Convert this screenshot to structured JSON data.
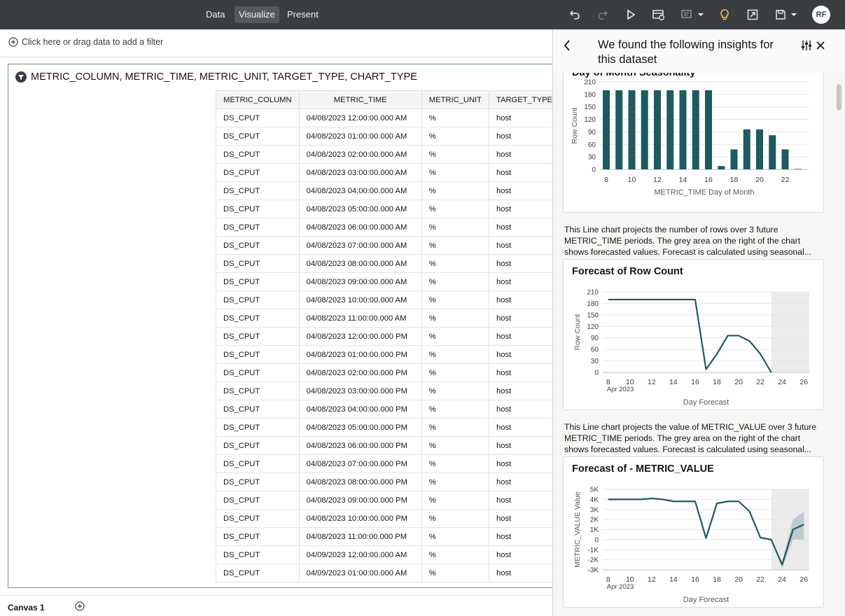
{
  "topbar": {
    "tabs": [
      {
        "label": "Data",
        "active": false
      },
      {
        "label": "Visualize",
        "active": true
      },
      {
        "label": "Present",
        "active": false
      }
    ],
    "icons": [
      "undo-icon",
      "redo-icon",
      "play-icon",
      "refresh-data-icon",
      "narrate-icon",
      "insights-bulb-icon",
      "export-icon",
      "save-icon"
    ],
    "avatar": "RF",
    "accent": "#f2c94c"
  },
  "filterbar": {
    "placeholder": "Click here or drag data to add a filter"
  },
  "viz": {
    "title": "METRIC_COLUMN, METRIC_TIME, METRIC_UNIT, TARGET_TYPE, CHART_TYPE",
    "columns": [
      "METRIC_COLUMN",
      "METRIC_TIME",
      "METRIC_UNIT",
      "TARGET_TYPE"
    ],
    "rows": [
      [
        "DS_CPUT",
        "04/08/2023 12:00:00.000 AM",
        "%",
        "host"
      ],
      [
        "DS_CPUT",
        "04/08/2023 01:00:00.000 AM",
        "%",
        "host"
      ],
      [
        "DS_CPUT",
        "04/08/2023 02:00:00.000 AM",
        "%",
        "host"
      ],
      [
        "DS_CPUT",
        "04/08/2023 03:00:00.000 AM",
        "%",
        "host"
      ],
      [
        "DS_CPUT",
        "04/08/2023 04:00:00.000 AM",
        "%",
        "host"
      ],
      [
        "DS_CPUT",
        "04/08/2023 05:00:00.000 AM",
        "%",
        "host"
      ],
      [
        "DS_CPUT",
        "04/08/2023 06:00:00.000 AM",
        "%",
        "host"
      ],
      [
        "DS_CPUT",
        "04/08/2023 07:00:00.000 AM",
        "%",
        "host"
      ],
      [
        "DS_CPUT",
        "04/08/2023 08:00:00.000 AM",
        "%",
        "host"
      ],
      [
        "DS_CPUT",
        "04/08/2023 09:00:00.000 AM",
        "%",
        "host"
      ],
      [
        "DS_CPUT",
        "04/08/2023 10:00:00.000 AM",
        "%",
        "host"
      ],
      [
        "DS_CPUT",
        "04/08/2023 11:00:00.000 AM",
        "%",
        "host"
      ],
      [
        "DS_CPUT",
        "04/08/2023 12:00:00.000 PM",
        "%",
        "host"
      ],
      [
        "DS_CPUT",
        "04/08/2023 01:00:00.000 PM",
        "%",
        "host"
      ],
      [
        "DS_CPUT",
        "04/08/2023 02:00:00.000 PM",
        "%",
        "host"
      ],
      [
        "DS_CPUT",
        "04/08/2023 03:00:00.000 PM",
        "%",
        "host"
      ],
      [
        "DS_CPUT",
        "04/08/2023 04:00:00.000 PM",
        "%",
        "host"
      ],
      [
        "DS_CPUT",
        "04/08/2023 05:00:00.000 PM",
        "%",
        "host"
      ],
      [
        "DS_CPUT",
        "04/08/2023 06:00:00.000 PM",
        "%",
        "host"
      ],
      [
        "DS_CPUT",
        "04/08/2023 07:00:00.000 PM",
        "%",
        "host"
      ],
      [
        "DS_CPUT",
        "04/08/2023 08:00:00.000 PM",
        "%",
        "host"
      ],
      [
        "DS_CPUT",
        "04/08/2023 09:00:00.000 PM",
        "%",
        "host"
      ],
      [
        "DS_CPUT",
        "04/08/2023 10:00:00.000 PM",
        "%",
        "host"
      ],
      [
        "DS_CPUT",
        "04/08/2023 11:00:00.000 PM",
        "%",
        "host"
      ],
      [
        "DS_CPUT",
        "04/09/2023 12:00:00.000 AM",
        "%",
        "host"
      ],
      [
        "DS_CPUT",
        "04/09/2023 01:00:00.000 AM",
        "%",
        "host"
      ]
    ]
  },
  "bottom": {
    "canvas_tab": "Canvas 1"
  },
  "panel": {
    "title": "We found the following insights for this dataset",
    "descriptions": [
      [
        "This Line chart projects the number of rows over 3 future",
        "METRIC_TIME periods. The grey area on the right of the chart",
        "shows forecasted values. Forecast is calculated using seasonal..."
      ],
      [
        "This Line chart projects the value of METRIC_VALUE over 3 future",
        "METRIC_TIME periods. The grey area on the right of the chart",
        "shows forecasted values. Forecast is calculated using seasonal..."
      ]
    ]
  },
  "chart_data": [
    {
      "type": "bar",
      "title": "Day of Month Seasonality",
      "xlabel": "METRIC_TIME Day of Month",
      "ylabel": "Row Count",
      "categories": [
        8,
        9,
        10,
        11,
        12,
        13,
        14,
        15,
        16,
        17,
        18,
        19,
        20,
        21,
        22,
        23
      ],
      "values": [
        190,
        190,
        190,
        190,
        190,
        190,
        190,
        190,
        190,
        8,
        48,
        96,
        96,
        82,
        48,
        1
      ],
      "ylim": [
        0,
        210
      ],
      "yticks": [
        0,
        30,
        60,
        90,
        120,
        150,
        180,
        210
      ],
      "xticks": [
        8,
        10,
        12,
        14,
        16,
        18,
        20,
        22
      ],
      "color": "#1e5a5f"
    },
    {
      "type": "line",
      "title": "Forecast of Row Count",
      "xlabel": "Day Forecast",
      "ylabel": "Row Count",
      "x": [
        8,
        9,
        10,
        11,
        12,
        13,
        14,
        15,
        16,
        17,
        18,
        19,
        20,
        21,
        22,
        23
      ],
      "values": [
        190,
        190,
        190,
        190,
        190,
        190,
        190,
        190,
        190,
        8,
        48,
        96,
        96,
        82,
        48,
        0
      ],
      "ylim": [
        0,
        210
      ],
      "yticks": [
        0,
        30,
        60,
        90,
        120,
        150,
        180,
        210
      ],
      "xticks": [
        8,
        10,
        12,
        14,
        16,
        18,
        20,
        22,
        24,
        26
      ],
      "xtick_sublabel": "Apr 2023",
      "forecast_start": 23,
      "xlim": [
        7.5,
        26.5
      ],
      "color": "#1e5a5f"
    },
    {
      "type": "area",
      "title": "Forecast of - METRIC_VALUE",
      "xlabel": "Day Forecast",
      "ylabel": "METRIC_VALUE Value",
      "x": [
        8,
        9,
        10,
        11,
        12,
        13,
        14,
        15,
        16,
        17,
        18,
        19,
        20,
        21,
        22,
        23,
        24,
        25,
        26
      ],
      "values": [
        4000,
        4000,
        4000,
        4000,
        4100,
        4000,
        3800,
        3800,
        3800,
        150,
        3600,
        3800,
        3800,
        2800,
        200,
        0,
        -2500,
        1000,
        1500
      ],
      "band_low": [
        null,
        null,
        null,
        null,
        null,
        null,
        null,
        null,
        null,
        null,
        null,
        null,
        null,
        null,
        null,
        0,
        -2800,
        0,
        0
      ],
      "band_high": [
        null,
        null,
        null,
        null,
        null,
        null,
        null,
        null,
        null,
        null,
        null,
        null,
        null,
        null,
        null,
        0,
        -2200,
        2000,
        2800
      ],
      "ylim": [
        -3000,
        5000
      ],
      "yticks": [
        "-3K",
        "-2K",
        "-1K",
        "0",
        "1K",
        "2K",
        "3K",
        "4K",
        "5K"
      ],
      "xticks": [
        8,
        10,
        12,
        14,
        16,
        18,
        20,
        22,
        24,
        26
      ],
      "xtick_sublabel": "Apr 2023",
      "forecast_start": 23,
      "xlim": [
        7.5,
        26.5
      ],
      "color": "#1e5a5f"
    }
  ]
}
